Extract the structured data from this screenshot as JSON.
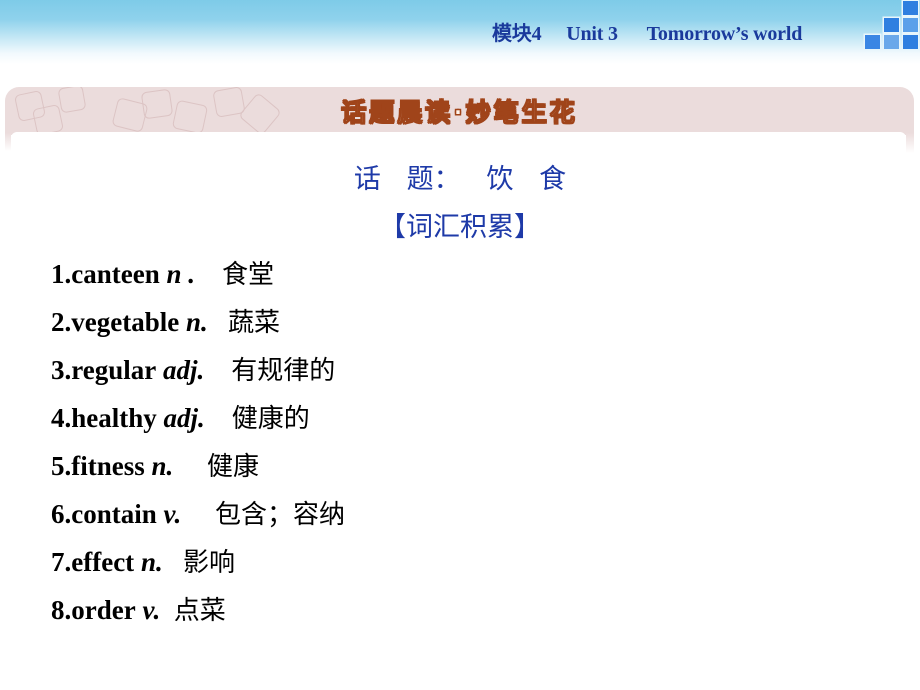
{
  "header": {
    "module": "模块4",
    "unit": "Unit 3",
    "title": "Tomorrow’s world",
    "logo_colors": [
      "#2f7fe0",
      "#3a86e4",
      "#5aa0ea",
      "#3a86e4",
      "#6aa8ea",
      "#2f7fe0"
    ]
  },
  "banner": {
    "title": "话题晨读·妙笔生花"
  },
  "topic": {
    "line": "话   题：   饮   食"
  },
  "section": {
    "title": "【词汇积累】"
  },
  "vocabulary": [
    {
      "num": "1.",
      "word": "canteen",
      "pos": "n .",
      "meaning": "食堂"
    },
    {
      "num": "2.",
      "word": "vegetable",
      "pos": "n.",
      "meaning": "蔬菜"
    },
    {
      "num": "3.",
      "word": "regular",
      "pos": "adj.",
      "meaning": "有规律的"
    },
    {
      "num": "4.",
      "word": "healthy",
      "pos": "adj.",
      "meaning": "健康的"
    },
    {
      "num": "5.",
      "word": "fitness",
      "pos": "n.",
      "meaning": "健康"
    },
    {
      "num": "6.",
      "word": "contain",
      "pos": "v.",
      "meaning": "包含；容纳"
    },
    {
      "num": "7.",
      "word": "effect",
      "pos": "n.",
      "meaning": "影响"
    },
    {
      "num": "8.",
      "word": "order",
      "pos": "v.",
      "meaning": "点菜"
    }
  ]
}
